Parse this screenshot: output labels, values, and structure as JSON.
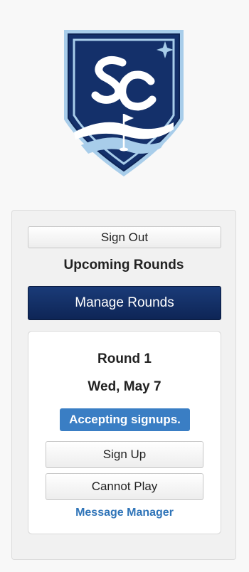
{
  "header": {
    "logo": {
      "icon": "sc-golf-crest-icon",
      "monogram": "SC"
    }
  },
  "panel": {
    "sign_out_label": "Sign Out",
    "section_title": "Upcoming Rounds",
    "manage_rounds_label": "Manage Rounds",
    "round": {
      "title": "Round 1",
      "date": "Wed, May 7",
      "status": "Accepting signups.",
      "sign_up_label": "Sign Up",
      "cannot_play_label": "Cannot Play",
      "message_manager_label": "Message Manager"
    }
  },
  "colors": {
    "brand_navy": "#0e2556",
    "status_blue": "#3a7ec4",
    "link_blue": "#2f74b8",
    "crest_light_blue": "#a8cdea"
  }
}
